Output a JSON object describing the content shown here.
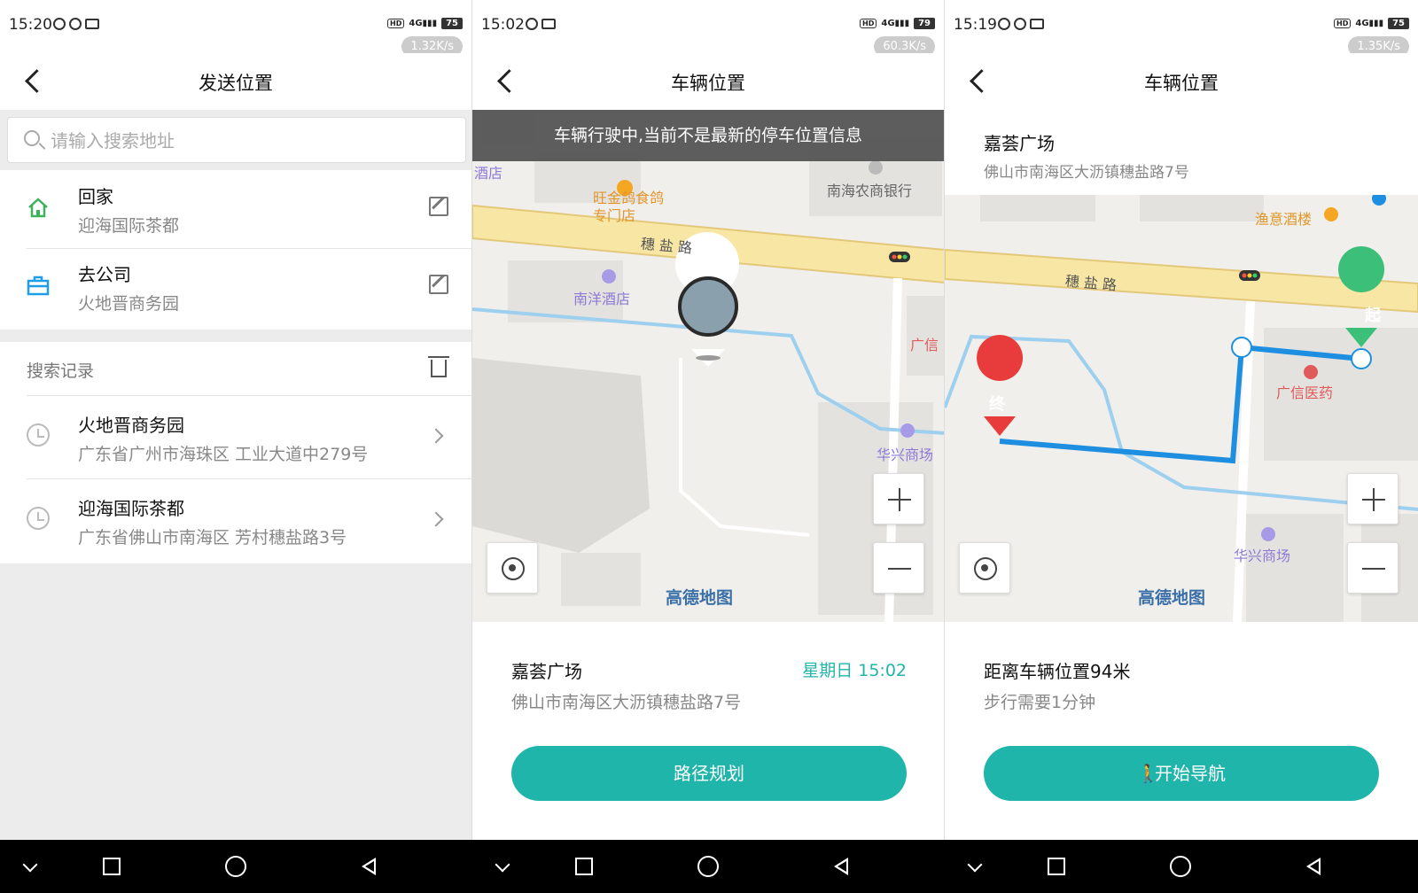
{
  "screens": [
    {
      "status": {
        "time": "15:20",
        "speed": "1.32K/s",
        "battery": "75"
      },
      "title": "发送位置",
      "search_placeholder": "请输入搜索地址",
      "quick": [
        {
          "name": "回家",
          "sub": "迎海国际茶都"
        },
        {
          "name": "去公司",
          "sub": "火地晋商务园"
        }
      ],
      "history_title": "搜索记录",
      "history": [
        {
          "name": "火地晋商务园",
          "sub": "广东省广州市海珠区 工业大道中279号"
        },
        {
          "name": "迎海国际茶都",
          "sub": "广东省佛山市南海区 芳村穗盐路3号"
        }
      ]
    },
    {
      "status": {
        "time": "15:02",
        "speed": "60.3K/s",
        "battery": "79"
      },
      "title": "车辆位置",
      "banner": "车辆行驶中,当前不是最新的停车位置信息",
      "map_labels": {
        "hotel1": "酒店",
        "restaurant": "旺金鸽食鸽专门店",
        "bank": "南海农商银行",
        "road": "穗 盐 路",
        "hotel2": "南洋酒店",
        "guangxin": "广信",
        "mall": "华兴商场"
      },
      "logo": "高德地图",
      "place": {
        "name": "嘉荟广场",
        "address": "佛山市南海区大沥镇穗盐路7号",
        "time": "星期日 15:02"
      },
      "button": "路径规划"
    },
    {
      "status": {
        "time": "15:19",
        "speed": "1.35K/s",
        "battery": "75"
      },
      "title": "车辆位置",
      "place": {
        "name": "嘉荟广场",
        "address": "佛山市南海区大沥镇穗盐路7号"
      },
      "map_labels": {
        "bar": "渔意酒楼",
        "road": "穗 盐 路",
        "pharmacy": "广信医药",
        "mall": "华兴商场",
        "start": "起",
        "end": "终"
      },
      "logo": "高德地图",
      "distance": "距离车辆位置94米",
      "walk_time": "步行需要1分钟",
      "button": "开始导航"
    }
  ],
  "colors": {
    "accent": "#20b5aa",
    "home": "#3cb35a",
    "work": "#1e9ee8",
    "route": "#1e8fe0",
    "start": "#3cc079",
    "end": "#e83b3b"
  }
}
